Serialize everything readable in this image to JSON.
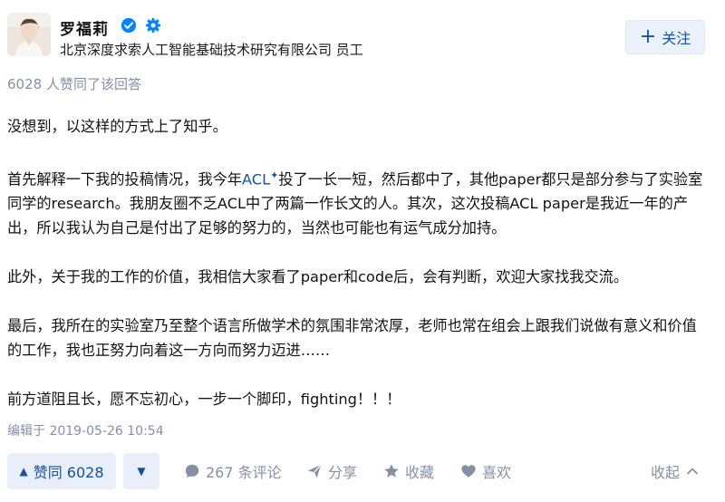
{
  "author": {
    "name": "罗福莉",
    "headline": "北京深度求索人工智能基础技术研究有限公司 员工",
    "verified_icon": "verified-badge-icon",
    "extra_icon": "gear-badge-icon"
  },
  "follow_button": {
    "label": "关注",
    "icon": "plus-icon"
  },
  "upvote_summary": "6028 人赞同了该回答",
  "content": {
    "p1": "没想到，以这样的方式上了知乎。",
    "p2_before_link": "首先解释一下我的投稿情况，我今年",
    "p2_link": "ACL",
    "p2_after_link": "投了一长一短，然后都中了，其他paper都只是部分参与了实验室同学的research。我朋友圈不乏ACL中了两篇一作长文的人。其次，这次投稿ACL paper是我近一年的产出，所以我认为自己是付出了足够的努力的，当然也可能也有运气成分加持。",
    "p3": "此外，关于我的工作的价值，我相信大家看了paper和code后，会有判断，欢迎大家找我交流。",
    "p4": "最后，我所在的实验室乃至整个语言所做学术的氛围非常浓厚，老师也常在组会上跟我们说做有意义和价值的工作，我也正努力向着这一方向而努力迈进……",
    "p5": "前方道阻且长，愿不忘初心，一步一个脚印，fighting！！！"
  },
  "edited": "编辑于 2019-05-26 10:54",
  "actions": {
    "vote_up_label": "赞同 6028",
    "comments_label": "267 条评论",
    "share_label": "分享",
    "favorite_label": "收藏",
    "like_label": "喜欢",
    "collapse_label": "收起"
  },
  "colors": {
    "accent": "#175199",
    "button_bg": "#e9effa",
    "muted": "#8590a6",
    "verified_blue": "#0084ff"
  }
}
